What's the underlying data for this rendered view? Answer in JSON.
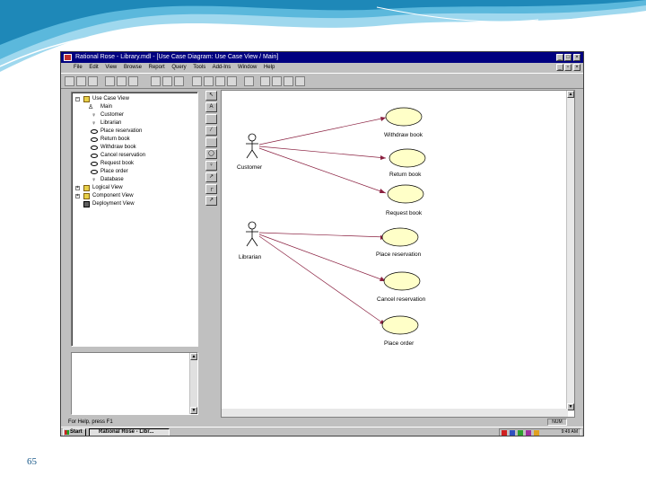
{
  "slide": {
    "number": "65",
    "colors": {
      "wave_dark": "#1e88b8",
      "wave_light": "#9fd8ee",
      "number_color": "#1a5a8a"
    }
  },
  "window": {
    "title": "Rational Rose - Library.mdl - [Use Case Diagram: Use Case View / Main]",
    "title_color": "#000080",
    "menu": [
      "File",
      "Edit",
      "View",
      "Browse",
      "Report",
      "Query",
      "Tools",
      "Add-Ins",
      "Window",
      "Help"
    ]
  },
  "browser": {
    "items": [
      {
        "label": "Use Case View",
        "icon": "folder-icon",
        "expander": "−"
      },
      {
        "label": "Main",
        "icon": "diagram-icon"
      },
      {
        "label": "Customer",
        "icon": "actor-icon"
      },
      {
        "label": "Librarian",
        "icon": "actor-icon"
      },
      {
        "label": "Place reservation",
        "icon": "use-case-icon"
      },
      {
        "label": "Return book",
        "icon": "use-case-icon"
      },
      {
        "label": "Withdraw book",
        "icon": "use-case-icon"
      },
      {
        "label": "Cancel reservation",
        "icon": "use-case-icon"
      },
      {
        "label": "Request book",
        "icon": "use-case-icon"
      },
      {
        "label": "Place order",
        "icon": "use-case-icon"
      },
      {
        "label": "Database",
        "icon": "actor-icon"
      },
      {
        "label": "Logical View",
        "icon": "folder-icon",
        "expander": "+"
      },
      {
        "label": "Component View",
        "icon": "folder-icon",
        "expander": "+"
      },
      {
        "label": "Deployment View",
        "icon": "deployment-icon"
      }
    ]
  },
  "diagram": {
    "actors": [
      {
        "name": "Customer",
        "icon": "actor-icon"
      },
      {
        "name": "Librarian",
        "icon": "actor-icon"
      }
    ],
    "use_cases": [
      {
        "name": "Withdraw book",
        "actor": "Customer"
      },
      {
        "name": "Return book",
        "actor": "Customer"
      },
      {
        "name": "Request book",
        "actor": "Customer"
      },
      {
        "name": "Place reservation",
        "actor": "Librarian"
      },
      {
        "name": "Cancel reservation",
        "actor": "Librarian"
      },
      {
        "name": "Place order",
        "actor": "Librarian"
      }
    ],
    "use_case_fill": "#ffffc8"
  },
  "status": {
    "help_text": "For Help, press F1",
    "numlock": "NUM"
  },
  "taskbar": {
    "start_label": "Start",
    "task_label": "Rational Rose - Libr...",
    "clock": "9:49 AM"
  }
}
